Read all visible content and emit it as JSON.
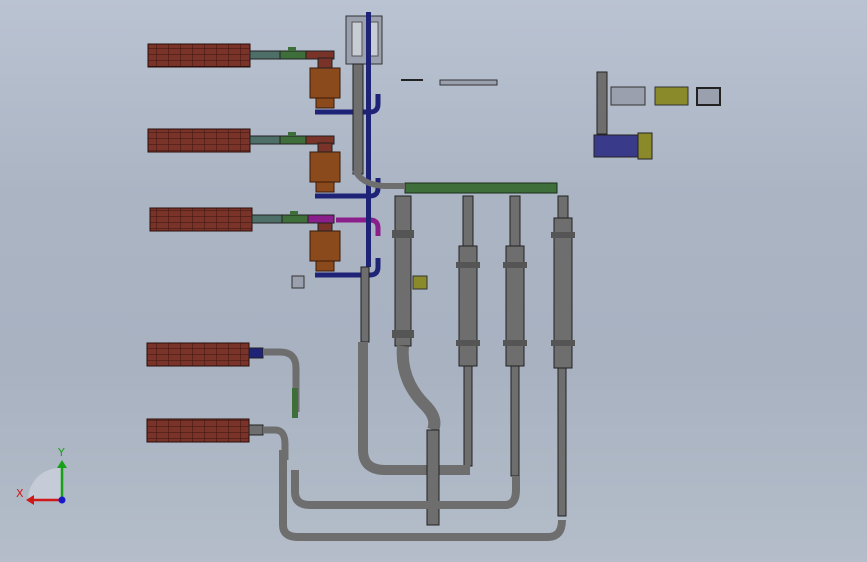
{
  "window": {
    "title": "",
    "background_top": "#bac3d2",
    "background_bottom": "#b4bdc9"
  },
  "triad": {
    "x_label": "X",
    "y_label": "Y",
    "x_color": "#d01818",
    "y_color": "#18a018",
    "z_color": "#1818c8"
  },
  "colors": {
    "heater_body": "#7a3328",
    "valve_brown": "#8a4a1c",
    "pipe_gray": "#6e6e6e",
    "pipe_navy": "#1f2378",
    "pipe_magenta": "#8a1e8a",
    "pipe_green": "#3e6e3a",
    "cabinet_gray": "#9aa0ad",
    "olive_box": "#8a8a2a",
    "motor_blue": "#3a3a8a"
  },
  "parts": {
    "heaters": [
      "heater-1",
      "heater-2",
      "heater-3",
      "heater-4",
      "heater-5"
    ],
    "columns": [
      "column-1",
      "column-2",
      "column-3",
      "column-4"
    ],
    "loose_parts": [
      "panel-gray",
      "panel-olive",
      "panel-small",
      "motor-unit"
    ]
  }
}
